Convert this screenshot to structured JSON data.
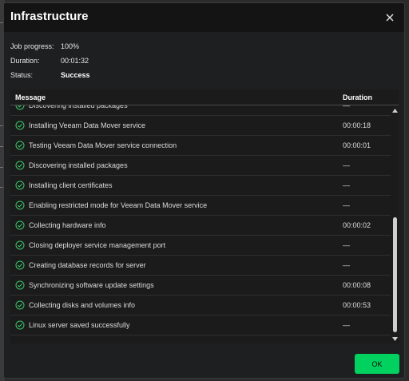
{
  "dialog": {
    "title": "Infrastructure",
    "close_icon": "close-icon"
  },
  "summary": {
    "job_progress_label": "Job progress:",
    "job_progress_value": "100%",
    "duration_label": "Duration:",
    "duration_value": "00:01:32",
    "status_label": "Status:",
    "status_value": "Success"
  },
  "table": {
    "headers": {
      "message": "Message",
      "duration": "Duration"
    },
    "rows": [
      {
        "message": "Discovering installed packages",
        "duration": "—",
        "icon": "check-circle-icon"
      },
      {
        "message": "Installing Veeam Data Mover service",
        "duration": "00:00:18",
        "icon": "check-circle-icon"
      },
      {
        "message": "Testing Veeam Data Mover service connection",
        "duration": "00:00:01",
        "icon": "check-circle-icon"
      },
      {
        "message": "Discovering installed packages",
        "duration": "—",
        "icon": "check-circle-icon"
      },
      {
        "message": "Installing client certificates",
        "duration": "—",
        "icon": "check-circle-icon"
      },
      {
        "message": "Enabling restricted mode for Veeam Data Mover service",
        "duration": "—",
        "icon": "check-circle-icon"
      },
      {
        "message": "Collecting hardware info",
        "duration": "00:00:02",
        "icon": "check-circle-icon"
      },
      {
        "message": "Closing deployer service management port",
        "duration": "—",
        "icon": "check-circle-icon"
      },
      {
        "message": "Creating database records for server",
        "duration": "—",
        "icon": "check-circle-icon"
      },
      {
        "message": "Synchronizing software update settings",
        "duration": "00:00:08",
        "icon": "check-circle-icon"
      },
      {
        "message": "Collecting disks and volumes info",
        "duration": "00:00:53",
        "icon": "check-circle-icon"
      },
      {
        "message": "Linux server saved successfully",
        "duration": "—",
        "icon": "check-circle-icon"
      }
    ]
  },
  "buttons": {
    "ok": "OK"
  },
  "colors": {
    "success_green": "#3cc46a",
    "ok_button": "#00d15f",
    "dialog_bg": "#1e1f20",
    "header_bg": "#141414"
  }
}
